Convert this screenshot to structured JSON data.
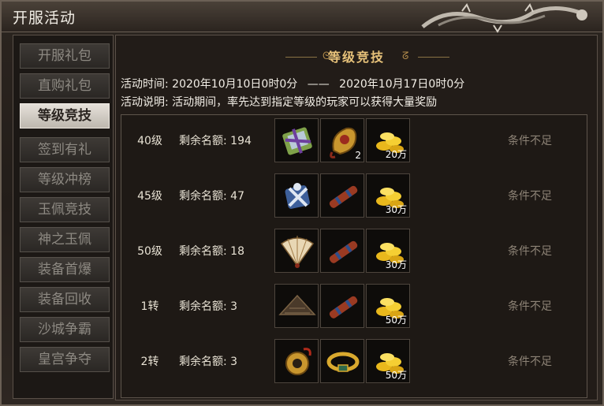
{
  "window": {
    "title": "开服活动"
  },
  "sidebar": {
    "items": [
      {
        "label": "开服礼包"
      },
      {
        "label": "直购礼包"
      },
      {
        "label": "等级竞技",
        "active": true
      },
      {
        "label": "签到有礼"
      },
      {
        "label": "等级冲榜"
      },
      {
        "label": "玉佩竞技"
      },
      {
        "label": "神之玉佩"
      },
      {
        "label": "装备首爆"
      },
      {
        "label": "装备回收"
      },
      {
        "label": "沙城争霸"
      },
      {
        "label": "皇宫争夺"
      }
    ]
  },
  "panel": {
    "title": "等级竞技",
    "time_label": "活动时间:",
    "time_start": "2020年10月10日0时0分",
    "time_sep": "——",
    "time_end": "2020年10月17日0时0分",
    "desc_label": "活动说明:",
    "desc_text": "活动期间，率先达到指定等级的玩家可以获得大量奖励"
  },
  "rows": [
    {
      "level": "40级",
      "quota_label": "剩余名额:",
      "quota": "194",
      "status": "条件不足",
      "rewards": [
        {
          "icon": "gift-bundle-icon",
          "count": ""
        },
        {
          "icon": "golden-amulet-icon",
          "count": "2"
        },
        {
          "icon": "gold-coins-icon",
          "count": "20万"
        }
      ]
    },
    {
      "level": "45级",
      "quota_label": "剩余名额:",
      "quota": "47",
      "status": "条件不足",
      "rewards": [
        {
          "icon": "blue-gift-icon",
          "count": ""
        },
        {
          "icon": "scroll-icon",
          "count": ""
        },
        {
          "icon": "gold-coins-icon",
          "count": "30万"
        }
      ]
    },
    {
      "level": "50级",
      "quota_label": "剩余名额:",
      "quota": "18",
      "status": "条件不足",
      "rewards": [
        {
          "icon": "folding-fan-icon",
          "count": ""
        },
        {
          "icon": "scroll-icon",
          "count": ""
        },
        {
          "icon": "gold-coins-icon",
          "count": "30万"
        }
      ]
    },
    {
      "level": "1转",
      "quota_label": "剩余名额:",
      "quota": "3",
      "status": "条件不足",
      "rewards": [
        {
          "icon": "straw-hat-icon",
          "count": ""
        },
        {
          "icon": "scroll-icon",
          "count": ""
        },
        {
          "icon": "gold-coins-icon",
          "count": "50万"
        }
      ]
    },
    {
      "level": "2转",
      "quota_label": "剩余名额:",
      "quota": "3",
      "status": "条件不足",
      "rewards": [
        {
          "icon": "jade-pendant-icon",
          "count": ""
        },
        {
          "icon": "golden-bracelet-icon",
          "count": ""
        },
        {
          "icon": "gold-coins-icon",
          "count": "50万"
        }
      ]
    }
  ]
}
